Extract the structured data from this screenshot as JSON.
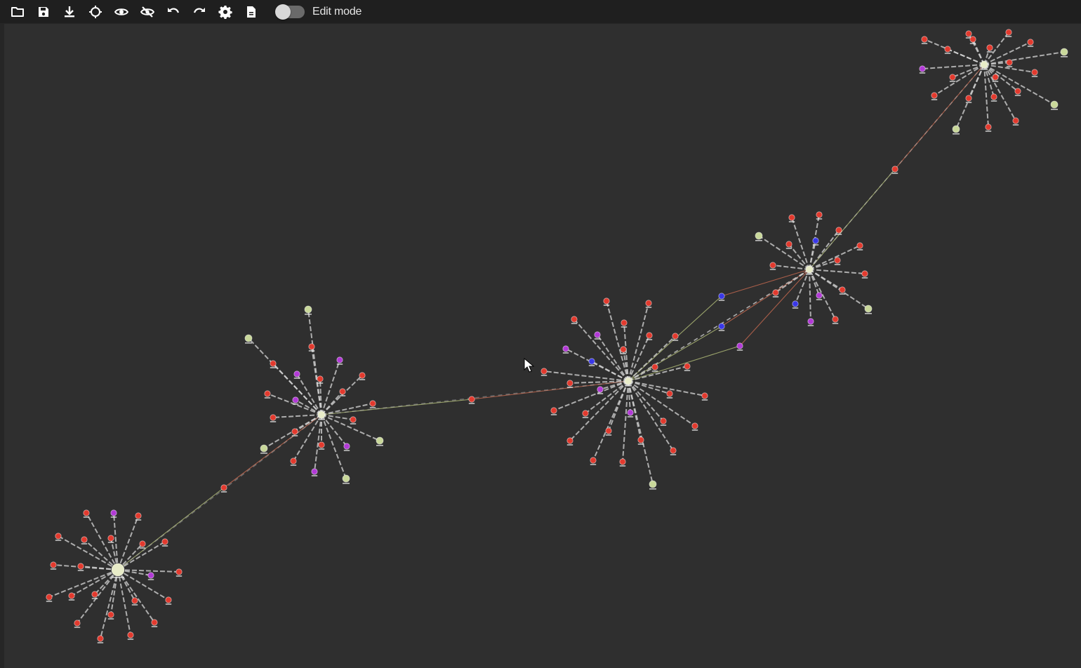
{
  "toolbar": {
    "buttons": [
      {
        "name": "open-folder-button",
        "icon": "folder-open-icon"
      },
      {
        "name": "save-button",
        "icon": "floppy-disk-icon"
      },
      {
        "name": "download-button",
        "icon": "download-icon"
      },
      {
        "name": "layout-button",
        "icon": "diamond-outline-icon"
      },
      {
        "name": "show-button",
        "icon": "eye-icon"
      },
      {
        "name": "hide-button",
        "icon": "eye-slash-icon"
      },
      {
        "name": "undo-button",
        "icon": "undo-icon"
      },
      {
        "name": "redo-button",
        "icon": "redo-icon"
      },
      {
        "name": "settings-button",
        "icon": "gear-icon"
      },
      {
        "name": "document-button",
        "icon": "document-icon"
      }
    ],
    "edit_mode": {
      "label": "Edit mode",
      "enabled": false
    }
  },
  "graph": {
    "background": "#2f2f2f",
    "node_colors": {
      "red": "#e23a2e",
      "purple": "#b23ad6",
      "blue": "#3a38e8",
      "lightgreen": "#c9d89a",
      "hub": "#e8ecc8"
    },
    "edge_color": "#d8d8d8"
  }
}
